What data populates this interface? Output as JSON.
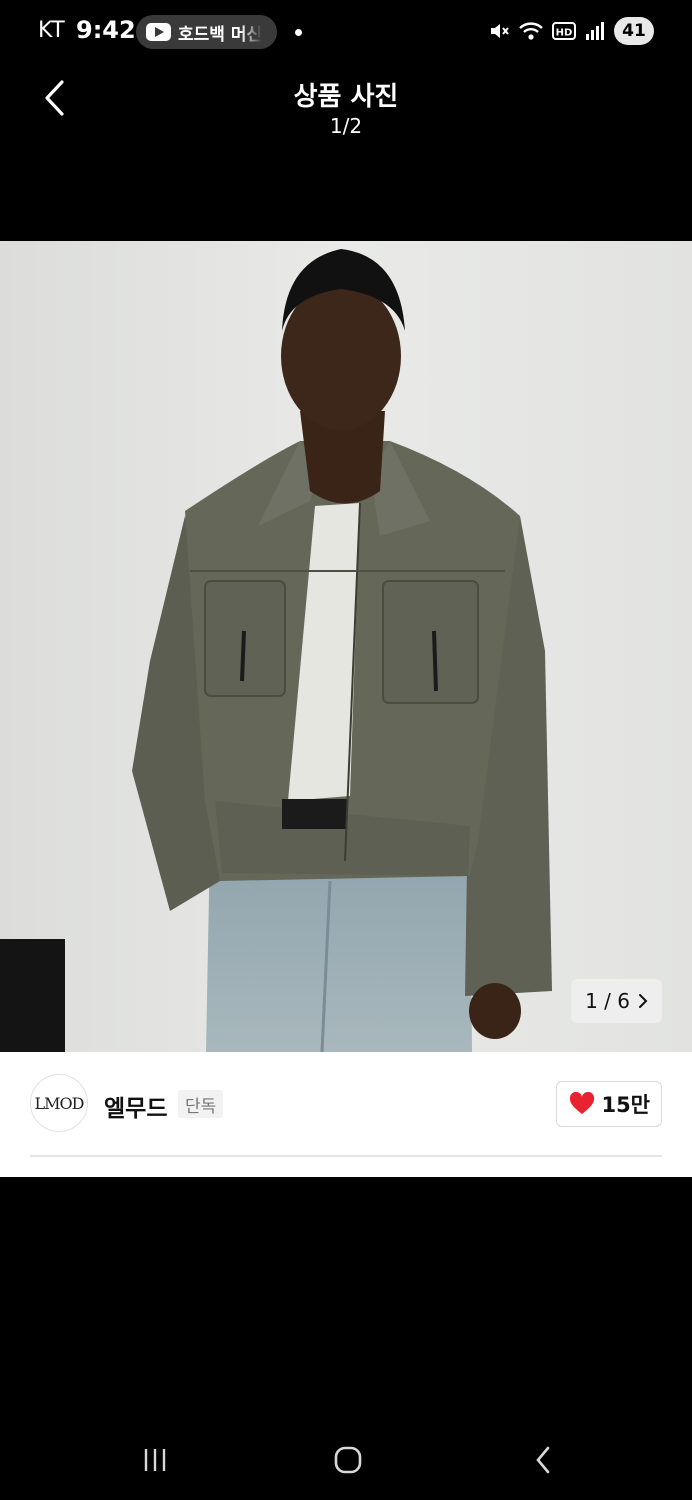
{
  "status_bar": {
    "carrier": "KT",
    "time": "9:42",
    "media_app_text": "호드백 머신",
    "battery_level": "41"
  },
  "header": {
    "title": "상품 사진",
    "counter": "1/2"
  },
  "photo": {
    "pager_text": "1 / 6"
  },
  "brand": {
    "logo_text": "LMOD",
    "name": "엘무드",
    "badge": "단독"
  },
  "like": {
    "count": "15만",
    "color": "#e8232f"
  }
}
